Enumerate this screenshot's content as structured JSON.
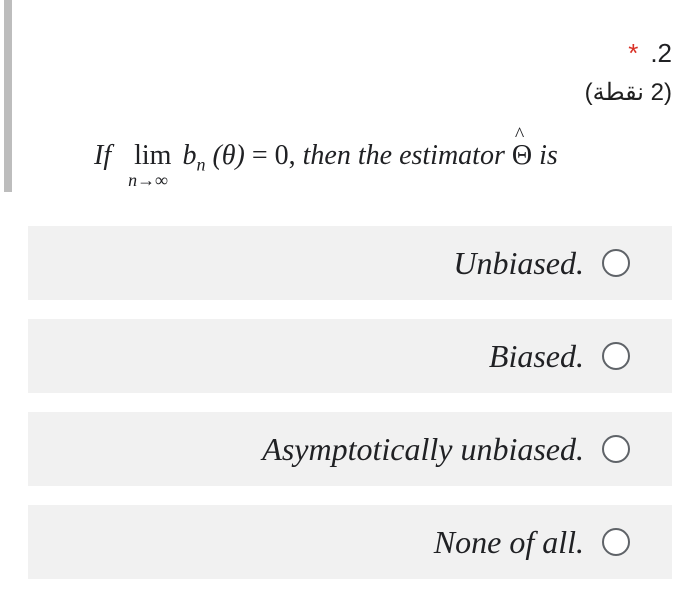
{
  "question": {
    "required_marker": "*",
    "number": ".2",
    "points": "(2 نقطة)",
    "text": {
      "if": "If",
      "lim": "lim",
      "lim_sub": "n→∞",
      "b": "b",
      "b_sub": "n",
      "arg": "(θ)",
      "equals_zero": "= 0,",
      "middle": "then the estimator",
      "theta": "Θ",
      "hat": "^",
      "end": "is"
    }
  },
  "options": [
    {
      "label": "Unbiased."
    },
    {
      "label": "Biased."
    },
    {
      "label": "Asymptotically unbiased."
    },
    {
      "label": "None of all."
    }
  ]
}
